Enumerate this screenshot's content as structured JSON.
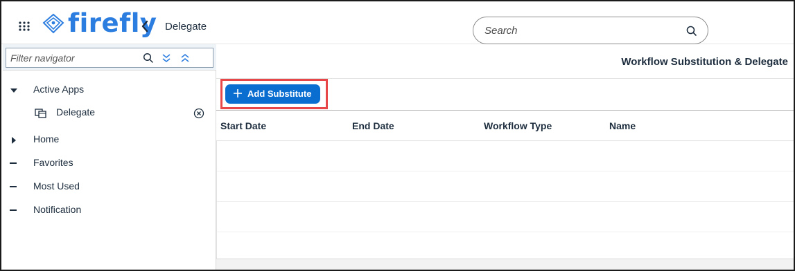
{
  "header": {
    "brand": "firefly",
    "title": "Delegate",
    "search_placeholder": "Search"
  },
  "sidebar": {
    "filter_placeholder": "Filter navigator",
    "active_apps_label": "Active Apps",
    "active_app_item": "Delegate",
    "items": [
      {
        "label": "Home"
      },
      {
        "label": "Favorites"
      },
      {
        "label": "Most Used"
      },
      {
        "label": "Notification"
      }
    ]
  },
  "main": {
    "page_title": "Workflow Substitution & Delegate",
    "add_button_label": "Add Substitute",
    "columns": [
      "Start Date",
      "End Date",
      "Workflow Type",
      "Name"
    ]
  },
  "colors": {
    "brand_blue": "#2c7de0",
    "button_blue": "#0a6ed1",
    "highlight_red": "#e8474a"
  },
  "icons": [
    "apps-grid-icon",
    "firefly-logo-icon",
    "chevron-left-icon",
    "search-icon",
    "expand-all-icon",
    "collapse-all-icon",
    "caret-down-icon",
    "caret-right-icon",
    "app-window-icon",
    "close-circle-icon",
    "plus-icon"
  ]
}
